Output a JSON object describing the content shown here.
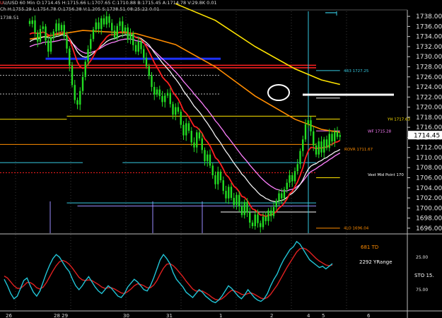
{
  "header": {
    "line1": "U/USD  60 Min  O:1714.45  H:1715.66  L:1707.65  C:1710.88  B:1715.45  A:1714.78  V:29.8K  0.01",
    "line2": "Ch  H:1755.29  L:1754.78  O:1756.38  V:1.205  S:1738.51  08:25:22  0.01",
    "line3": "1738.51"
  },
  "colors": {
    "background": "#000000",
    "candle": "#22dd22",
    "ema_red": "#ff2020",
    "ema_white": "#f2f2f2",
    "ema_pink": "#ff80ff",
    "ma_orange": "#ff8c00",
    "ma_yellow": "#ffe400",
    "stoch_cyan": "#21c4d6",
    "stoch_red": "#e02020",
    "level_blue": "#1e32ff",
    "level_cyan": "#35c9e0"
  },
  "chart_data": [
    {
      "type": "candlestick",
      "timeframe": "60 Min",
      "ylim": [
        1695,
        1739
      ],
      "y_ticks": [
        "1738.00",
        "1736.00",
        "1734.00",
        "1732.00",
        "1730.00",
        "1728.00",
        "1726.00",
        "1724.00",
        "1722.00",
        "1720.00",
        "1718.00",
        "1716.00",
        "1714.00",
        "1712.00",
        "1710.00",
        "1708.00",
        "1706.00",
        "1704.00",
        "1702.00",
        "1700.00",
        "1698.00",
        "1696.00"
      ],
      "last_price": "1714.45",
      "closes": [
        1736.5,
        1737.2,
        1734.8,
        1733.0,
        1735.5,
        1736.0,
        1733.2,
        1731.0,
        1733.8,
        1735.0,
        1736.6,
        1735.2,
        1736.3,
        1734.0,
        1731.6,
        1728.2,
        1724.4,
        1721.4,
        1720.5,
        1723.2,
        1726.0,
        1729.0,
        1731.5,
        1733.5,
        1735.4,
        1736.8,
        1735.5,
        1737.6,
        1736.4,
        1738.0,
        1736.7,
        1735.2,
        1733.8,
        1736.1,
        1737.0,
        1734.9,
        1735.8,
        1733.4,
        1734.6,
        1732.3,
        1731.0,
        1733.0,
        1731.5,
        1729.8,
        1728.1,
        1726.2,
        1724.0,
        1722.5,
        1723.5,
        1722.2,
        1721.0,
        1722.3,
        1722.8,
        1720.6,
        1718.5,
        1720.0,
        1719.1,
        1716.5,
        1714.4,
        1716.8,
        1715.3,
        1713.0,
        1712.0,
        1715.0,
        1713.8,
        1711.5,
        1709.3,
        1710.6,
        1708.4,
        1706.5,
        1704.7,
        1707.2,
        1705.5,
        1703.4,
        1701.9,
        1704.2,
        1702.0,
        1700.6,
        1702.6,
        1700.3,
        1698.6,
        1701.2,
        1699.1,
        1697.1,
        1696.4,
        1698.7,
        1697.0,
        1696.2,
        1698.3,
        1697.4,
        1699.5,
        1698.4,
        1700.2,
        1701.4,
        1702.9,
        1701.9,
        1703.7,
        1705.0,
        1706.5,
        1705.3,
        1707.3,
        1708.7,
        1711.3,
        1713.6,
        1716.6,
        1717.4,
        1715.2,
        1712.4,
        1710.6,
        1713.2,
        1711.0,
        1713.6,
        1711.9,
        1714.7,
        1713.2,
        1715.1,
        1714.1,
        1714.45
      ],
      "ema_red": [
        1734.5,
        1734.7,
        1734.7,
        1734.6,
        1734.7,
        1734.9,
        1734.7,
        1734.3,
        1734.2,
        1734.3,
        1734.6,
        1734.7,
        1734.9,
        1734.8,
        1734.4,
        1733.4,
        1732.0,
        1730.4,
        1728.9,
        1728.0,
        1727.7,
        1727.9,
        1728.5,
        1729.2,
        1730.1,
        1731.1,
        1731.7,
        1732.6,
        1733.2,
        1733.9,
        1734.3,
        1734.4,
        1734.3,
        1734.6,
        1734.9,
        1734.9,
        1735.0,
        1734.7,
        1734.7,
        1734.3,
        1733.8,
        1733.7,
        1733.4,
        1732.8,
        1732.0,
        1731.0,
        1729.9,
        1728.8,
        1727.9,
        1727.0,
        1726.0,
        1725.4,
        1724.9,
        1724.1,
        1723.0,
        1722.3,
        1721.6,
        1720.5,
        1719.3,
        1718.8,
        1718.1,
        1717.1,
        1716.2,
        1716.0,
        1715.5,
        1714.8,
        1713.7,
        1713.1,
        1712.3,
        1711.2,
        1710.0,
        1709.5,
        1708.7,
        1707.7,
        1706.6,
        1706.1,
        1705.2,
        1704.3,
        1703.9,
        1703.2,
        1702.3,
        1702.1,
        1701.5,
        1700.6,
        1699.8,
        1699.6,
        1699.1,
        1698.6,
        1698.6,
        1698.3,
        1698.6,
        1698.6,
        1698.9,
        1699.3,
        1700.0,
        1700.4,
        1701.0,
        1701.8,
        1702.8,
        1703.3,
        1704.2,
        1705.2,
        1706.5,
        1708.0,
        1709.9,
        1711.3,
        1712.0,
        1712.0,
        1711.7,
        1712.0,
        1711.8,
        1712.1,
        1712.0,
        1712.5,
        1712.6,
        1713.0,
        1713.1,
        1713.4
      ],
      "ema_white": [
        1733.0,
        1733.3,
        1733.5,
        1733.5,
        1733.7,
        1733.9,
        1733.9,
        1733.8,
        1733.7,
        1733.8,
        1734.0,
        1734.1,
        1734.3,
        1734.3,
        1734.1,
        1733.6,
        1732.8,
        1731.9,
        1731.0,
        1730.4,
        1730.0,
        1729.9,
        1730.0,
        1730.3,
        1730.7,
        1731.2,
        1731.6,
        1732.1,
        1732.5,
        1733.0,
        1733.3,
        1733.5,
        1733.6,
        1733.8,
        1734.1,
        1734.2,
        1734.3,
        1734.3,
        1734.3,
        1734.1,
        1733.9,
        1733.8,
        1733.6,
        1733.2,
        1732.8,
        1732.3,
        1731.6,
        1730.8,
        1730.2,
        1729.5,
        1728.8,
        1728.2,
        1727.6,
        1727.0,
        1726.2,
        1725.6,
        1724.9,
        1724.1,
        1723.2,
        1722.5,
        1721.8,
        1721.0,
        1720.2,
        1719.6,
        1719.0,
        1718.3,
        1717.5,
        1716.8,
        1716.0,
        1715.2,
        1714.3,
        1713.6,
        1712.9,
        1712.0,
        1711.2,
        1710.5,
        1709.7,
        1708.9,
        1708.2,
        1707.5,
        1706.7,
        1706.2,
        1705.5,
        1704.8,
        1704.2,
        1703.7,
        1703.1,
        1702.6,
        1702.3,
        1701.9,
        1701.7,
        1701.4,
        1701.3,
        1701.2,
        1701.4,
        1701.5,
        1701.7,
        1702.1,
        1702.6,
        1702.9,
        1703.4,
        1704.0,
        1704.7,
        1705.6,
        1706.7,
        1707.7,
        1708.3,
        1708.6,
        1708.8,
        1709.2,
        1709.4,
        1709.8,
        1710.0,
        1710.4,
        1710.7,
        1711.1,
        1711.3,
        1711.6
      ],
      "ema_pink": [
        1732.0,
        1732.2,
        1732.4,
        1732.5,
        1732.6,
        1732.8,
        1732.9,
        1732.9,
        1732.9,
        1733.0,
        1733.1,
        1733.2,
        1733.4,
        1733.4,
        1733.4,
        1733.1,
        1732.7,
        1732.2,
        1731.6,
        1731.2,
        1730.9,
        1730.7,
        1730.7,
        1730.8,
        1731.0,
        1731.2,
        1731.5,
        1731.8,
        1732.1,
        1732.4,
        1732.6,
        1732.8,
        1732.9,
        1733.1,
        1733.3,
        1733.4,
        1733.5,
        1733.5,
        1733.5,
        1733.4,
        1733.2,
        1733.1,
        1733.0,
        1732.7,
        1732.4,
        1732.0,
        1731.6,
        1731.1,
        1730.6,
        1730.1,
        1729.6,
        1729.1,
        1728.6,
        1728.1,
        1727.5,
        1727.0,
        1726.4,
        1725.8,
        1725.1,
        1724.5,
        1723.9,
        1723.3,
        1722.6,
        1722.0,
        1721.4,
        1720.8,
        1720.1,
        1719.5,
        1718.8,
        1718.1,
        1717.3,
        1716.7,
        1716.0,
        1715.3,
        1714.5,
        1713.9,
        1713.2,
        1712.5,
        1711.8,
        1711.1,
        1710.4,
        1709.8,
        1709.2,
        1708.5,
        1707.9,
        1707.3,
        1706.7,
        1706.1,
        1705.6,
        1705.1,
        1704.7,
        1704.3,
        1704.0,
        1703.7,
        1703.6,
        1703.4,
        1703.4,
        1703.4,
        1703.6,
        1703.7,
        1703.9,
        1704.3,
        1704.7,
        1705.3,
        1706.0,
        1706.7,
        1707.2,
        1707.5,
        1707.8,
        1708.2,
        1708.5,
        1708.9,
        1709.2,
        1709.6,
        1709.9,
        1710.3,
        1710.6,
        1710.9
      ],
      "ma_orange_from": [
        0,
        1733.5
      ],
      "ma_orange": [
        [
          0,
          1733.5
        ],
        [
          20,
          1735.2
        ],
        [
          40,
          1734.6
        ],
        [
          55,
          1732.4
        ],
        [
          70,
          1728.0
        ],
        [
          85,
          1722.2
        ],
        [
          100,
          1717.6
        ],
        [
          110,
          1715.6
        ],
        [
          117,
          1715.0
        ]
      ],
      "ma_yellow": [
        [
          55,
          1740.5
        ],
        [
          70,
          1737.2
        ],
        [
          85,
          1732.0
        ],
        [
          100,
          1727.6
        ],
        [
          110,
          1725.4
        ],
        [
          117,
          1724.5
        ]
      ],
      "levels": [
        {
          "name": "red_band_top",
          "y": 1728.3,
          "color": "#ff2020",
          "from": 0,
          "to": 108
        },
        {
          "name": "red_band_bot",
          "y": 1727.8,
          "color": "#ff2020",
          "from": 0,
          "to": 108
        },
        {
          "name": "blue_level",
          "y": 1729.6,
          "color": "#1e32ff",
          "from": 6,
          "to": 72
        },
        {
          "name": "dashed_white",
          "y": 1726.3,
          "color": "#bbbbbb",
          "from": 0,
          "to": 72,
          "dash": true
        },
        {
          "name": "dashed_white2",
          "y": 1722.6,
          "color": "#bbbbbb",
          "from": 0,
          "to": 72,
          "dash": true
        },
        {
          "name": "yellow_step",
          "y": 1717.6,
          "color": "#ffe400",
          "from": 0,
          "to": 14
        },
        {
          "name": "yellow_level",
          "y": 1718.2,
          "color": "#ffe400",
          "from": 14,
          "to": 108
        },
        {
          "name": "yh_level",
          "y": 1717.63,
          "color": "#ffe400",
          "from": 108,
          "to": 117
        },
        {
          "name": "wf_level",
          "y": 1715.28,
          "color": "#ff80ff",
          "from": 108,
          "to": 117
        },
        {
          "name": "orange_level",
          "y": 1712.6,
          "color": "#ff8c00",
          "from": 0,
          "to": 108
        },
        {
          "name": "white_level",
          "y": 1721.8,
          "color": "#ffffff",
          "from": 108,
          "to": 117
        },
        {
          "name": "cyan_level",
          "y": 1727.25,
          "color": "#35c9e0",
          "from": 108,
          "to": 117
        },
        {
          "name": "cyan_low",
          "y": 1709.0,
          "color": "#35c9e0",
          "from": 0,
          "to": 20
        },
        {
          "name": "cyan_low2",
          "y": 1709.0,
          "color": "#35c9e0",
          "from": 35,
          "to": 108
        },
        {
          "name": "cyan_bottom",
          "y": 1701.0,
          "color": "#35c9e0",
          "from": 14,
          "to": 108
        },
        {
          "name": "purple_box_top",
          "y": 1700.4,
          "color": "#9a8cff",
          "from": 18,
          "to": 108
        },
        {
          "name": "white_box_top",
          "y": 1699.2,
          "color": "#ffffff",
          "from": 72,
          "to": 108
        },
        {
          "name": "orange_low",
          "y": 1696.0,
          "color": "#ff8c00",
          "from": 108,
          "to": 117
        },
        {
          "name": "yellow_mid",
          "y": 1706.0,
          "color": "#ffe400",
          "from": 108,
          "to": 117
        },
        {
          "name": "red_dotted",
          "y": 1707.0,
          "color": "#ff2020",
          "from": 0,
          "to": 108,
          "dash": true
        }
      ],
      "price_labels": [
        {
          "text": "4R3  1727.25",
          "y": 1727.25,
          "color": "#35c9e0"
        },
        {
          "text": "YH  1717.63",
          "y": 1717.63,
          "color": "#ffe400"
        },
        {
          "text": "WF  1715.28",
          "y": 1715.28,
          "color": "#ff80ff"
        },
        {
          "text": "ROVR  1711.67",
          "y": 1711.67,
          "color": "#ff8c00"
        },
        {
          "text": "Vest Mid Point  170",
          "y": 1706.6,
          "color": "#ffffff"
        },
        {
          "text": "4LO  1696.04",
          "y": 1696.04,
          "color": "#ff8c00"
        }
      ],
      "x_labels": [
        "26",
        "28 29",
        "30",
        "31",
        "1",
        "2",
        "4",
        "5",
        "6"
      ]
    },
    {
      "type": "line",
      "name": "STO",
      "ylim": [
        0,
        100
      ],
      "y_ticks": [
        "25.00",
        "75.00"
      ],
      "stoch_k": [
        40,
        30,
        18,
        10,
        14,
        26,
        38,
        42,
        30,
        20,
        14,
        22,
        36,
        50,
        62,
        72,
        78,
        74,
        66,
        58,
        52,
        40,
        30,
        24,
        30,
        38,
        44,
        36,
        28,
        22,
        18,
        24,
        30,
        26,
        20,
        14,
        12,
        18,
        28,
        34,
        40,
        36,
        30,
        24,
        22,
        30,
        42,
        56,
        70,
        78,
        72,
        64,
        50,
        40,
        34,
        28,
        20,
        16,
        12,
        18,
        24,
        20,
        14,
        10,
        6,
        4,
        8,
        14,
        22,
        30,
        26,
        20,
        14,
        10,
        16,
        24,
        18,
        12,
        8,
        6,
        10,
        18,
        30,
        40,
        48,
        60,
        70,
        78,
        86,
        90,
        98,
        94,
        86,
        78,
        70,
        66,
        62,
        58,
        60,
        56,
        60,
        64
      ],
      "stoch_red": [
        45,
        42,
        36,
        30,
        26,
        26,
        30,
        35,
        35,
        32,
        27,
        25,
        28,
        35,
        44,
        53,
        61,
        67,
        69,
        67,
        63,
        57,
        50,
        43,
        39,
        38,
        39,
        38,
        35,
        32,
        28,
        26,
        27,
        27,
        25,
        22,
        19,
        18,
        21,
        25,
        30,
        33,
        32,
        30,
        27,
        27,
        31,
        38,
        48,
        57,
        63,
        64,
        61,
        56,
        50,
        44,
        37,
        31,
        25,
        22,
        22,
        22,
        19,
        16,
        12,
        9,
        8,
        10,
        14,
        19,
        23,
        22,
        20,
        17,
        16,
        18,
        19,
        17,
        14,
        11,
        10,
        12,
        17,
        24,
        31,
        40,
        49,
        58,
        66,
        74,
        82,
        87,
        88,
        86,
        82,
        77,
        72,
        68,
        65,
        62,
        61,
        62
      ],
      "labels": [
        "681 TD",
        "2292 YRange",
        "STO  15."
      ]
    }
  ]
}
